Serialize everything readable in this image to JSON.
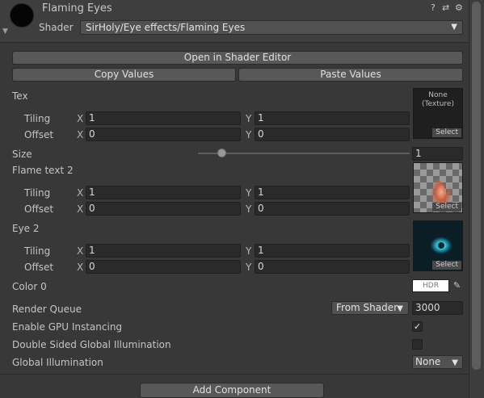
{
  "header": {
    "title": "Flaming Eyes",
    "icons": [
      "help-icon",
      "presets-icon",
      "settings-icon"
    ],
    "help_glyph": "?",
    "presets_glyph": "⇄",
    "settings_glyph": "⚙",
    "shader_label": "Shader",
    "shader_value": "SirHoly/Eye effects/Flaming Eyes"
  },
  "toolbar": {
    "open_editor": "Open in Shader Editor",
    "copy_values": "Copy Values",
    "paste_values": "Paste Values"
  },
  "tex": {
    "label": "Tex",
    "tiling_label": "Tiling",
    "offset_label": "Offset",
    "x": "X",
    "y": "Y",
    "tiling_x": "1",
    "tiling_y": "1",
    "offset_x": "0",
    "offset_y": "0",
    "slot_text": "None\n(Texture)",
    "select": "Select"
  },
  "size": {
    "label": "Size",
    "value": "1",
    "slider_fraction": 0.11
  },
  "flame_text_2": {
    "label": "Flame text 2",
    "tiling_label": "Tiling",
    "offset_label": "Offset",
    "x": "X",
    "y": "Y",
    "tiling_x": "1",
    "tiling_y": "1",
    "offset_x": "0",
    "offset_y": "0",
    "select": "Select"
  },
  "eye_2": {
    "label": "Eye 2",
    "tiling_label": "Tiling",
    "offset_label": "Offset",
    "x": "X",
    "y": "Y",
    "tiling_x": "1",
    "tiling_y": "1",
    "offset_x": "0",
    "offset_y": "0",
    "select": "Select"
  },
  "color_0": {
    "label": "Color 0",
    "hdr": "HDR",
    "swatch_color": "#ffffff"
  },
  "render_queue": {
    "label": "Render Queue",
    "mode": "From Shader",
    "value": "3000"
  },
  "gpu_instancing": {
    "label": "Enable GPU Instancing",
    "checked": true,
    "check_glyph": "✓"
  },
  "double_sided_gi": {
    "label": "Double Sided Global Illumination",
    "checked": false
  },
  "global_illumination": {
    "label": "Global Illumination",
    "value": "None"
  },
  "footer": {
    "add_component": "Add Component"
  }
}
